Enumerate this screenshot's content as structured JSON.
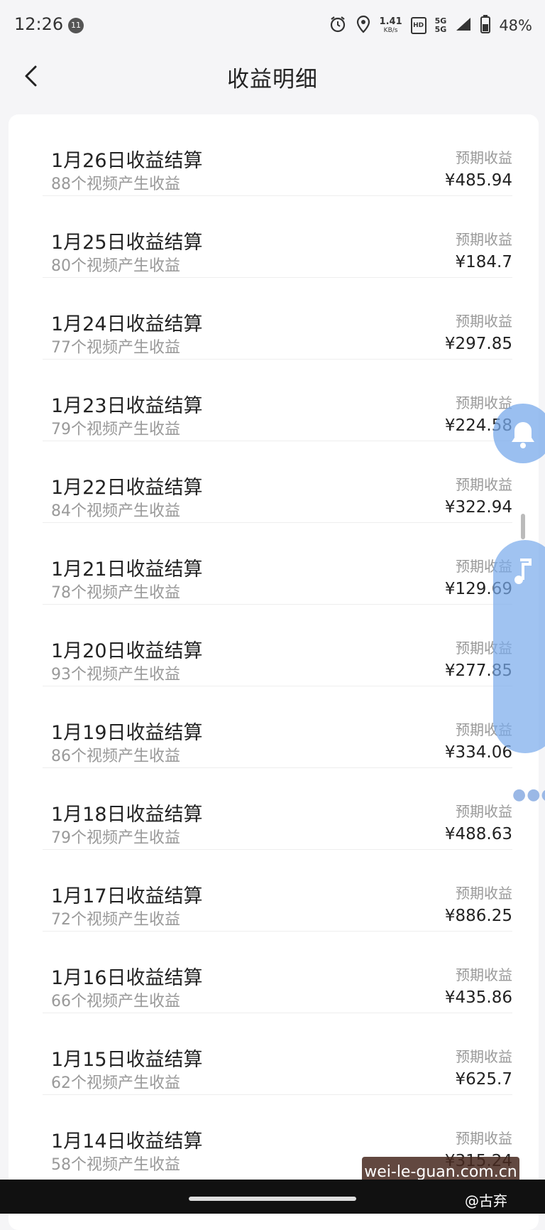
{
  "status_bar": {
    "time": "12:26",
    "notification_count": "11",
    "net_speed": "1.41",
    "net_speed_unit": "KB/s",
    "hd_label": "HD",
    "network_top": "5G",
    "network_bottom": "5G",
    "battery": "48%"
  },
  "header": {
    "title": "收益明细"
  },
  "earnings": [
    {
      "title": "1月26日收益结算",
      "subtitle": "88个视频产生收益",
      "label": "预期收益",
      "amount": "¥485.94"
    },
    {
      "title": "1月25日收益结算",
      "subtitle": "80个视频产生收益",
      "label": "预期收益",
      "amount": "¥184.7"
    },
    {
      "title": "1月24日收益结算",
      "subtitle": "77个视频产生收益",
      "label": "预期收益",
      "amount": "¥297.85"
    },
    {
      "title": "1月23日收益结算",
      "subtitle": "79个视频产生收益",
      "label": "预期收益",
      "amount": "¥224.58"
    },
    {
      "title": "1月22日收益结算",
      "subtitle": "84个视频产生收益",
      "label": "预期收益",
      "amount": "¥322.94"
    },
    {
      "title": "1月21日收益结算",
      "subtitle": "78个视频产生收益",
      "label": "预期收益",
      "amount": "¥129.69"
    },
    {
      "title": "1月20日收益结算",
      "subtitle": "93个视频产生收益",
      "label": "预期收益",
      "amount": "¥277.85"
    },
    {
      "title": "1月19日收益结算",
      "subtitle": "86个视频产生收益",
      "label": "预期收益",
      "amount": "¥334.06"
    },
    {
      "title": "1月18日收益结算",
      "subtitle": "79个视频产生收益",
      "label": "预期收益",
      "amount": "¥488.63"
    },
    {
      "title": "1月17日收益结算",
      "subtitle": "72个视频产生收益",
      "label": "预期收益",
      "amount": "¥886.25"
    },
    {
      "title": "1月16日收益结算",
      "subtitle": "66个视频产生收益",
      "label": "预期收益",
      "amount": "¥435.86"
    },
    {
      "title": "1月15日收益结算",
      "subtitle": "62个视频产生收益",
      "label": "预期收益",
      "amount": "¥625.7"
    },
    {
      "title": "1月14日收益结算",
      "subtitle": "58个视频产生收益",
      "label": "预期收益",
      "amount": "¥315.24"
    }
  ],
  "watermark": {
    "site": "wei-le-guan.com.cn",
    "author": "@古弃"
  },
  "colors": {
    "background": "#f5f5f7",
    "card": "#ffffff",
    "primary_text": "#222222",
    "secondary_text": "#999999",
    "float_widget": "#78aaeb"
  },
  "icons": [
    "back-arrow-icon",
    "alarm-icon",
    "location-icon",
    "signal-icon",
    "battery-icon",
    "bell-icon",
    "music-note-icon",
    "more-dots-icon"
  ]
}
